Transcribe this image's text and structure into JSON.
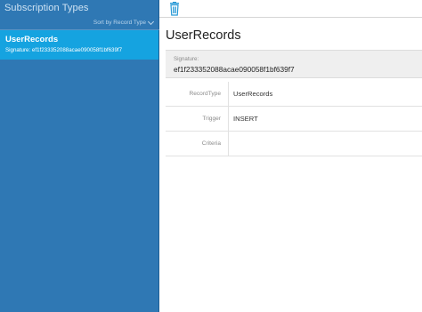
{
  "sidebar": {
    "title": "Subscription Types",
    "sort_label": "Sort by Record Type",
    "items": [
      {
        "name": "UserRecords",
        "signature": "Signature: ef1f233352088acae090058f1bf639f7"
      }
    ]
  },
  "toolbar": {
    "delete_icon": "trash-icon"
  },
  "detail": {
    "title": "UserRecords",
    "signature_label": "Signature:",
    "signature_value": "ef1f233352088acae090058f1bf639f7",
    "rows": [
      {
        "key": "RecordType",
        "value": "UserRecords"
      },
      {
        "key": "Trigger",
        "value": "INSERT"
      },
      {
        "key": "Criteria",
        "value": ""
      }
    ]
  },
  "colors": {
    "sidebar_bg": "#2f78b4",
    "selected_item": "#15a3e0",
    "accent_icon": "#2a9ad6"
  }
}
